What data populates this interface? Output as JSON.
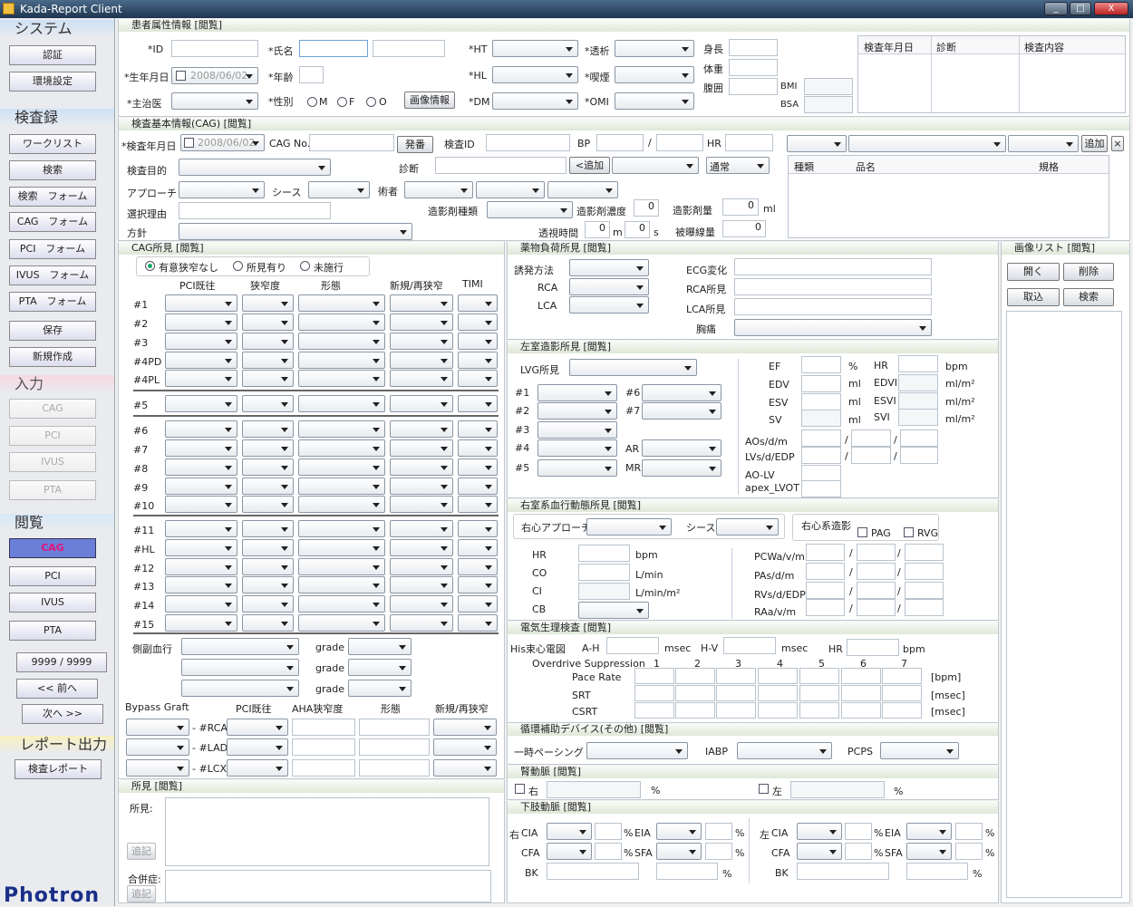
{
  "window": {
    "title": "Kada-Report Client",
    "min": "_",
    "max": "□",
    "close": "X"
  },
  "sidebar": {
    "system": "システム",
    "auth": "認証",
    "env": "環境設定",
    "records": "検査録",
    "worklist": "ワークリスト",
    "search": "検索",
    "search_form": "検索　フォーム",
    "cag_form": "CAG　フォーム",
    "pci_form": "PCI　フォーム",
    "ivus_form": "IVUS　フォーム",
    "pta_form": "PTA　フォーム",
    "save": "保存",
    "new": "新規作成",
    "input": "入力",
    "in_cag": "CAG",
    "in_pci": "PCI",
    "in_ivus": "IVUS",
    "in_pta": "PTA",
    "browse": "閲覧",
    "b_cag": "CAG",
    "b_pci": "PCI",
    "b_ivus": "IVUS",
    "b_pta": "PTA",
    "counter": "9999 / 9999",
    "prev": "<< 前へ",
    "next": "次へ >>",
    "report": "レポート出力",
    "report_btn": "検査レポート",
    "logo": "Photron"
  },
  "patient": {
    "header": "患者属性情報 [閲覧]",
    "id": "*ID",
    "name": "*氏名",
    "dob": "*生年月日",
    "dob_val": "2008/06/02",
    "age": "*年齢",
    "doctor": "*主治医",
    "sex": "*性別",
    "m": "M",
    "f": "F",
    "o": "O",
    "image_btn": "画像情報",
    "ht": "*HT",
    "dialysis": "*透析",
    "hl": "*HL",
    "smoke": "*喫煙",
    "dm": "*DM",
    "omi": "*OMI",
    "height": "身長",
    "weight": "体重",
    "waist": "腹囲",
    "bmi": "BMI",
    "bsa": "BSA",
    "hist_cols": [
      "検査年月日",
      "診断",
      "検査内容"
    ]
  },
  "cag": {
    "header": "検査基本情報(CAG) [閲覧]",
    "exam_date": "*検査年月日",
    "exam_date_val": "2008/06/02",
    "cag_no": "CAG No.",
    "issue": "発番",
    "exam_id": "検査ID",
    "bp": "BP",
    "slash": "/",
    "hr": "HR",
    "add": "追加",
    "del": "×",
    "purpose": "検査目的",
    "diagnosis": "診断",
    "add_left": "<追加",
    "normal": "通常",
    "approach": "アプローチ",
    "sheath": "シース",
    "operator": "術者",
    "reason": "選択理由",
    "contrast_type": "造影剤種類",
    "contrast_conc": "造影剤濃度",
    "conc_val": "0",
    "contrast_vol": "造影剤量",
    "vol_val": "0",
    "ml": "ml",
    "policy": "方針",
    "fluoro": "透視時間",
    "m_val": "0",
    "m": "m",
    "s_val": "0",
    "s": "s",
    "exposure": "被曝線量",
    "exp_val": "0",
    "tbl_cols": [
      "種類",
      "品名",
      "規格"
    ]
  },
  "findings": {
    "header": "CAG所見 [閲覧]",
    "r1": "有意狭窄なし",
    "r2": "所見有り",
    "r3": "未施行",
    "cols": [
      "PCI既往",
      "狭窄度",
      "形態",
      "新規/再狭窄",
      "TIMI"
    ],
    "segs": [
      "#1",
      "#2",
      "#3",
      "#4PD",
      "#4PL",
      "#5",
      "#6",
      "#7",
      "#8",
      "#9",
      "#10",
      "#11",
      "#HL",
      "#12",
      "#13",
      "#14",
      "#15"
    ],
    "collateral": "側副血行",
    "grade": "grade",
    "bypass": "Bypass Graft",
    "bp_cols": [
      "PCI既往",
      "AHA狭窄度",
      "形態",
      "新規/再狭窄"
    ],
    "bp_rows": [
      "- #RCA",
      "- #LAD",
      "- #LCX"
    ]
  },
  "notes": {
    "header": "所見 [閲覧]",
    "findings": "所見:",
    "add1": "追記",
    "comp": "合併症:",
    "add2": "追記"
  },
  "drug": {
    "header": "薬物負荷所見 [閲覧]",
    "method": "誘発方法",
    "rca": "RCA",
    "lca": "LCA",
    "ecg": "ECG変化",
    "rca_f": "RCA所見",
    "lca_f": "LCA所見",
    "chest": "胸痛"
  },
  "lv": {
    "header": "左室造影所見 [閲覧]",
    "lvg": "LVG所見",
    "segs": [
      "#1",
      "#2",
      "#3",
      "#4",
      "#5"
    ],
    "segs2": [
      "#6",
      "#7"
    ],
    "ar": "AR",
    "mr": "MR",
    "ef": "EF",
    "pct": "%",
    "hr": "HR",
    "bpm": "bpm",
    "edv": "EDV",
    "ml": "ml",
    "edvi": "EDVI",
    "mlm2": "ml/m²",
    "esv": "ESV",
    "esvi": "ESVI",
    "sv": "SV",
    "svi": "SVI",
    "aos": "AOs/d/m",
    "lvs": "LVs/d/EDP",
    "aolv": "AO-LV",
    "apex": "apex_LVOT",
    "slash": "/"
  },
  "rh": {
    "header": "右室系血行動態所見 [閲覧]",
    "approach": "右心アプローチ",
    "sheath": "シース",
    "angio": "右心系造影",
    "pag": "PAG",
    "rvg": "RVG",
    "hr": "HR",
    "bpm": "bpm",
    "co": "CO",
    "lmin": "L/min",
    "ci": "CI",
    "lminm2": "L/min/m²",
    "cb": "CB",
    "pcw": "PCWa/v/m",
    "pas": "PAs/d/m",
    "rvs": "RVs/d/EDP",
    "raa": "RAa/v/m",
    "slash": "/"
  },
  "ep": {
    "header": "電気生理検査 [閲覧]",
    "his": "His束心電図",
    "ah": "A-H",
    "msec": "msec",
    "hv": "H-V",
    "hr": "HR",
    "bpm": "bpm",
    "overdrive": "Overdrive Suppression",
    "nums": [
      "1",
      "2",
      "3",
      "4",
      "5",
      "6",
      "7"
    ],
    "pace": "Pace Rate",
    "srt": "SRT",
    "csrt": "CSRT",
    "u1": "[bpm]",
    "u2": "[msec]",
    "u3": "[msec]"
  },
  "assist": {
    "header": "循環補助デバイス(その他) [閲覧]",
    "temp": "一時ペーシング",
    "iabp": "IABP",
    "pcps": "PCPS"
  },
  "renal": {
    "header": "腎動脈 [閲覧]",
    "right": "右",
    "left": "左",
    "pct": "%"
  },
  "lower": {
    "header": "下肢動脈 [閲覧]",
    "right": "右",
    "left": "左",
    "cia": "CIA",
    "eia": "EIA",
    "cfa": "CFA",
    "sfa": "SFA",
    "bk": "BK",
    "pct": "%"
  },
  "images": {
    "header": "画像リスト [閲覧]",
    "open": "開く",
    "del": "削除",
    "import": "取込",
    "search": "検索"
  }
}
